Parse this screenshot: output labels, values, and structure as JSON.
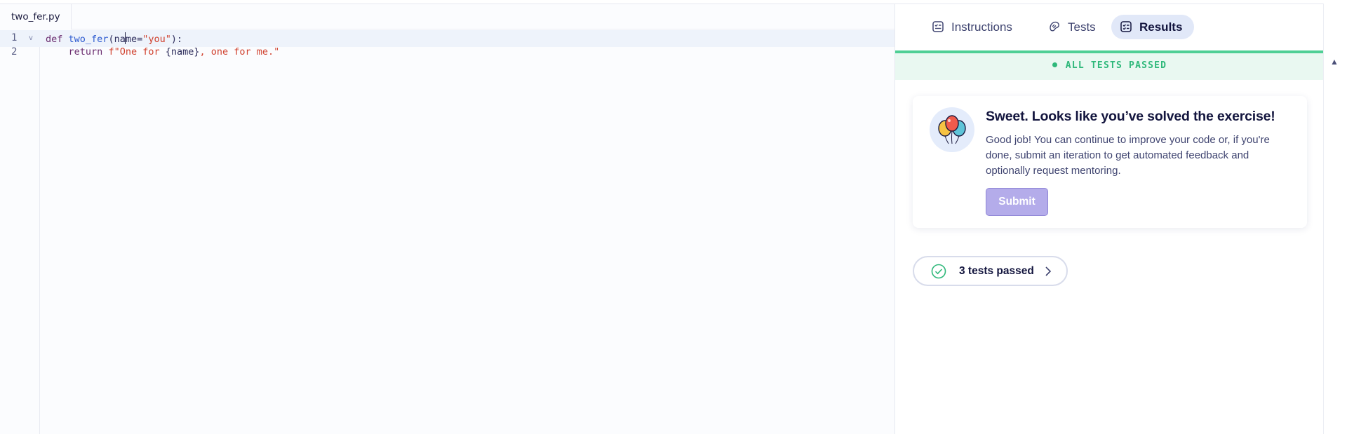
{
  "editor": {
    "file_tab": "two_fer.py",
    "lines": [
      {
        "number": "1",
        "fold": "v"
      },
      {
        "number": "2",
        "fold": ""
      }
    ],
    "code": {
      "line1": {
        "kw_def": "def",
        "fn_name": "two_fer",
        "open": "(na",
        "after_cursor": "me=",
        "default": "\"you\"",
        "close": "):"
      },
      "line2": {
        "indent": "    ",
        "kw_return": "return",
        "fstring_start": "f\"One for ",
        "interp": "{name}",
        "fstring_end": ", one for me.\""
      }
    }
  },
  "panel": {
    "tabs": [
      {
        "label": "Instructions",
        "icon": "instructions-icon"
      },
      {
        "label": "Tests",
        "icon": "tests-icon"
      },
      {
        "label": "Results",
        "icon": "results-icon",
        "selected": true
      }
    ],
    "status": "ALL TESTS PASSED",
    "card": {
      "icon": "balloons-icon",
      "title": "Sweet. Looks like you’ve solved the exercise!",
      "text": "Good job! You can continue to improve your code or, if you're done, submit an iteration to get automated feedback and optionally request mentoring.",
      "submit_label": "Submit"
    },
    "tests_summary": {
      "label": "3 tests passed",
      "icon": "check-circle-icon"
    }
  },
  "colors": {
    "success": "#2eb87a",
    "success_bg": "#e9f8f1",
    "submit_bg": "#b4acea",
    "selected_tab_bg": "#e1e8f8",
    "text_dark": "#13153e"
  }
}
